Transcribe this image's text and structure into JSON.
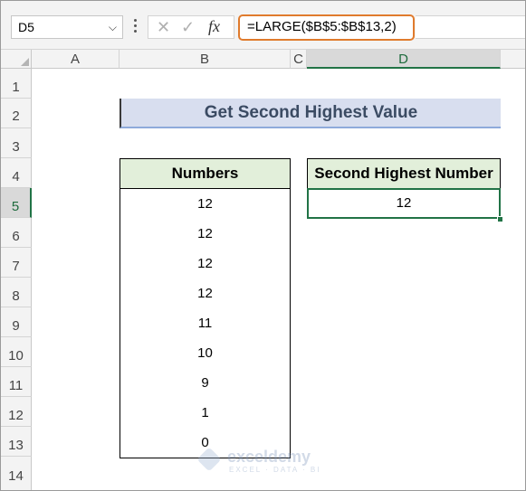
{
  "name_box": {
    "value": "D5"
  },
  "formula_bar": {
    "cancel_glyph": "✕",
    "enter_glyph": "✓",
    "fx_label": "fx",
    "formula": "=LARGE($B$5:$B$13,2)"
  },
  "columns": [
    "A",
    "B",
    "C",
    "D"
  ],
  "rows": [
    "1",
    "2",
    "3",
    "4",
    "5",
    "6",
    "7",
    "8",
    "9",
    "10",
    "11",
    "12",
    "13",
    "14"
  ],
  "sheet": {
    "title": "Get Second Highest Value",
    "numbers_header": "Numbers",
    "numbers": [
      "12",
      "12",
      "12",
      "12",
      "11",
      "10",
      "9",
      "1",
      "0"
    ],
    "result_header": "Second Highest Number",
    "result_value": "12"
  },
  "watermark": {
    "name": "exceldemy",
    "tagline": "EXCEL · DATA · BI"
  },
  "colors": {
    "accent": "#217346",
    "formula_highlight": "#e07b2d",
    "title_fill": "#d8deef",
    "header_fill": "#e2efda"
  }
}
